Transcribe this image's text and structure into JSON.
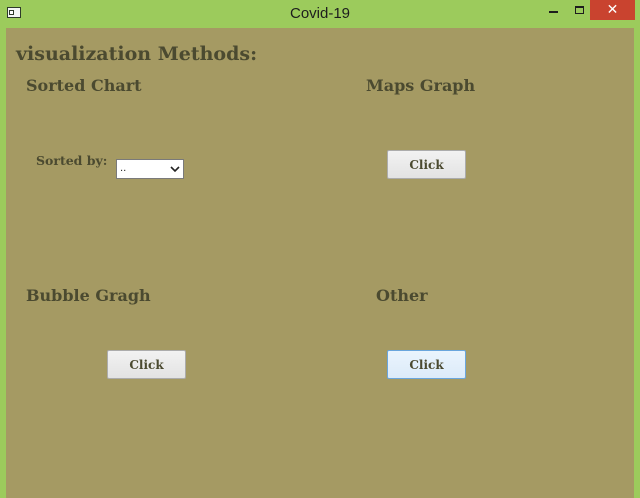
{
  "window": {
    "title": "Covid-19",
    "close_glyph": "✕"
  },
  "main": {
    "heading": "visualization Methods:"
  },
  "sections": {
    "sorted_chart": {
      "title": "Sorted Chart",
      "sorted_by_label": "Sorted by:",
      "select_value": ".."
    },
    "maps_graph": {
      "title": "Maps Graph",
      "button": "Click"
    },
    "bubble_graph": {
      "title": "Bubble Gragh",
      "button": "Click"
    },
    "other": {
      "title": "Other",
      "button": "Click"
    }
  },
  "colors": {
    "titlebar": "#9ccb5c",
    "panel": "#a59a63",
    "text": "#4b4a30",
    "close": "#c9432f"
  }
}
